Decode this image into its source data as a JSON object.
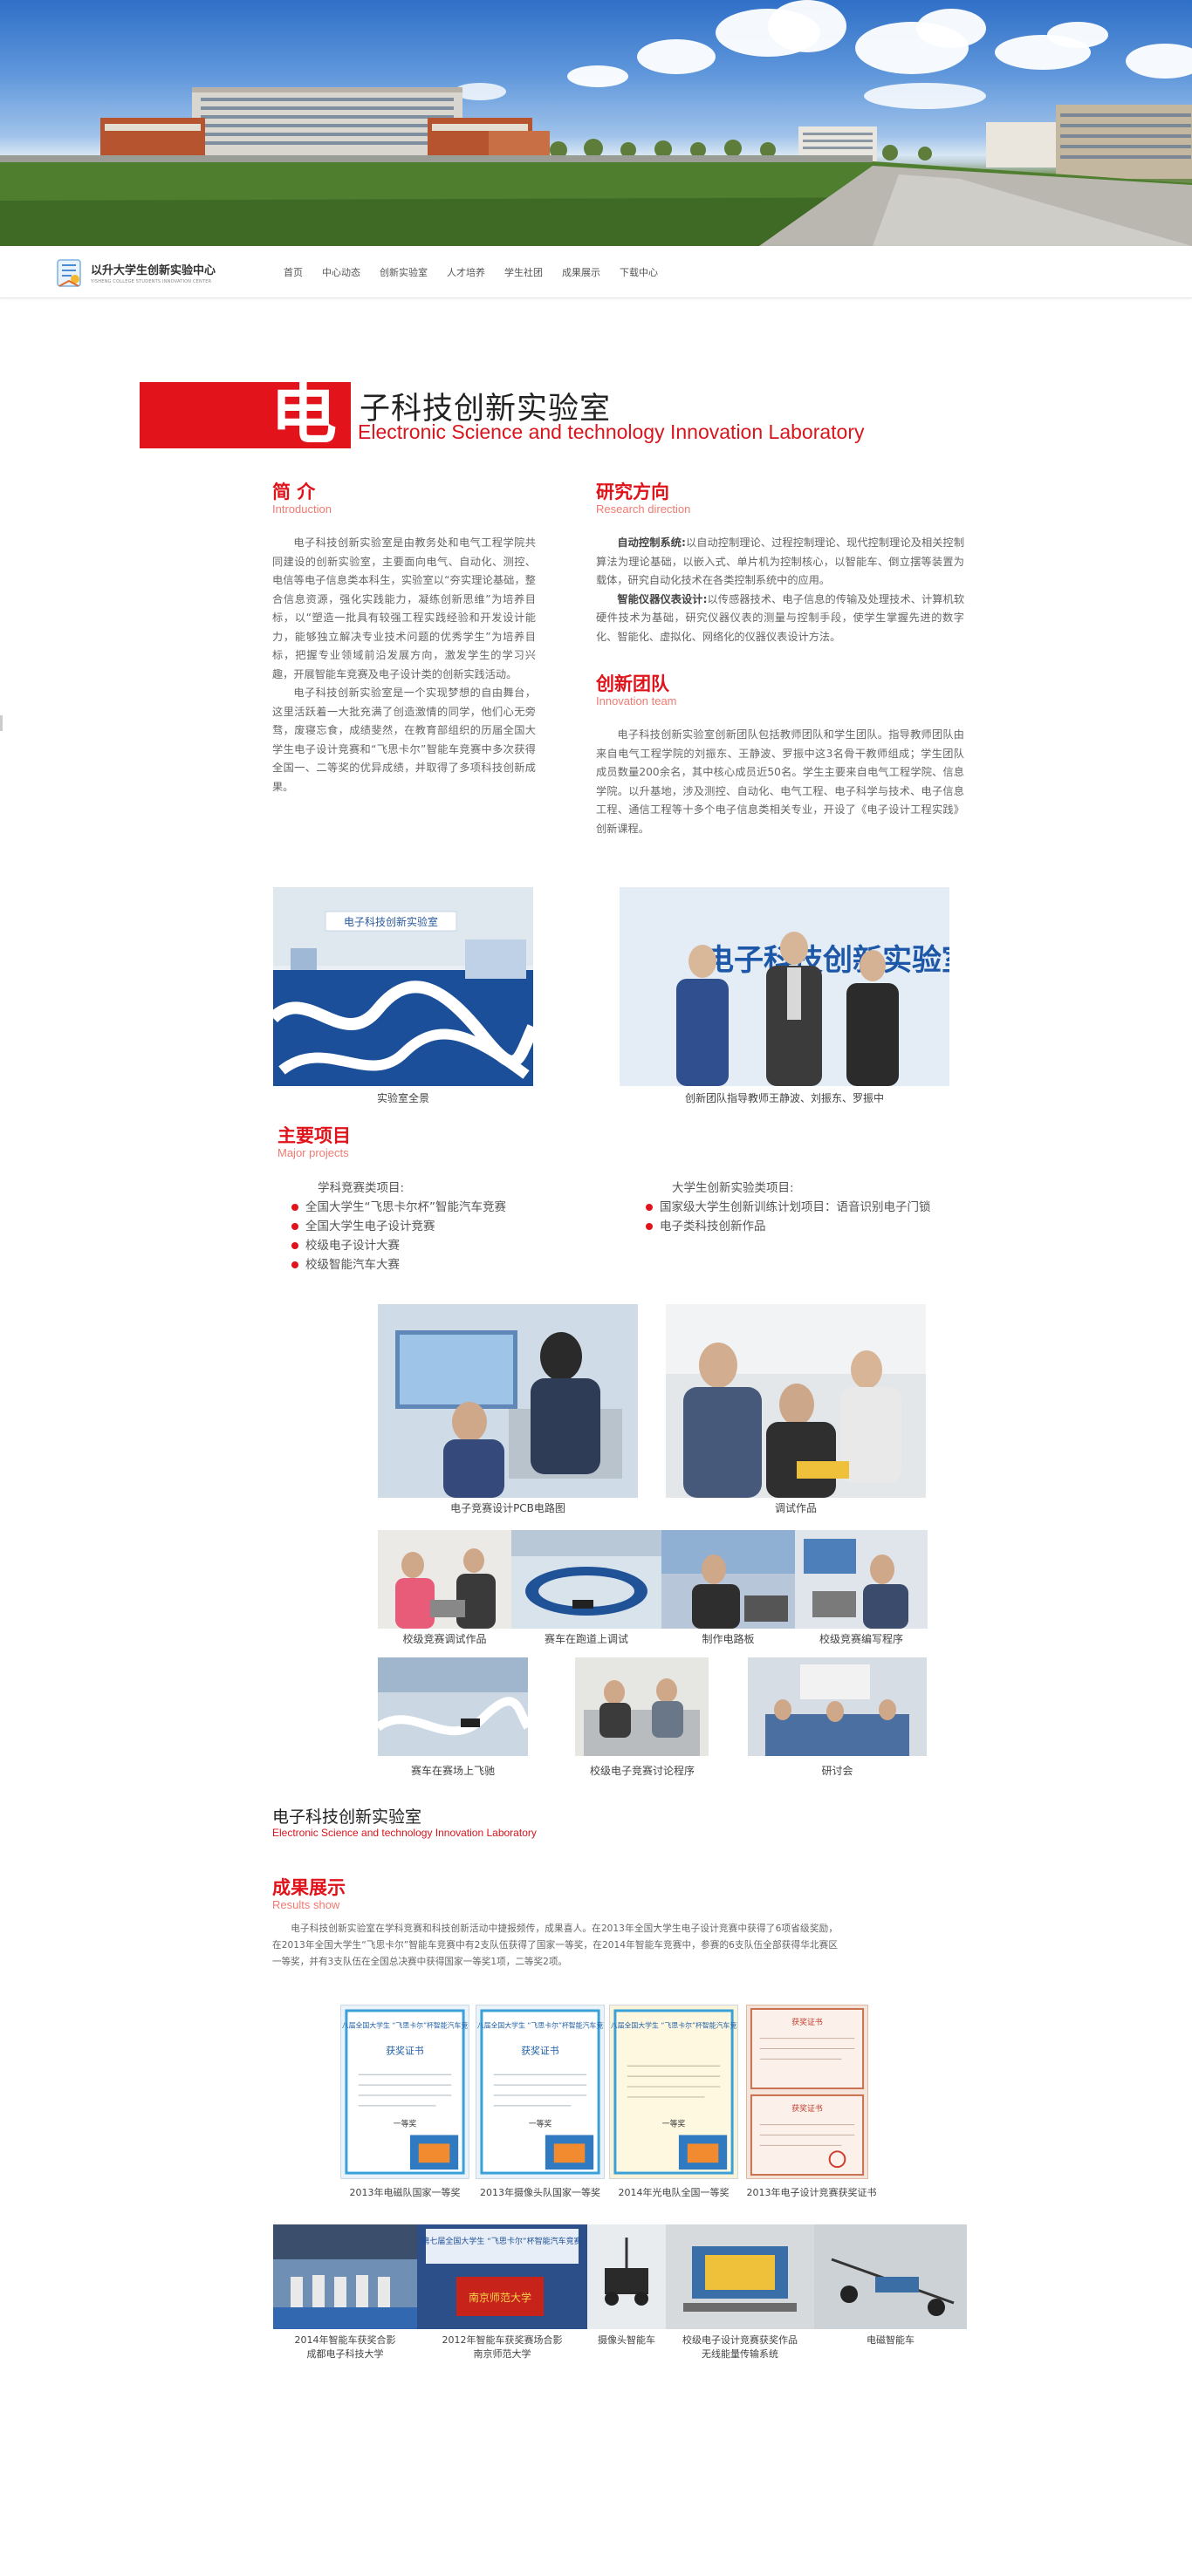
{
  "header": {
    "logo_title": "以升大学生创新实验中心",
    "logo_subtitle": "YISHENG COLLEGE STUDENTS INNOVATION CENTER",
    "nav": [
      "首页",
      "中心动态",
      "创新实验室",
      "人才培养",
      "学生社团",
      "成果展示",
      "下载中心"
    ]
  },
  "lab": {
    "big_char": "电",
    "title_cn": "子科技创新实验室",
    "title_en": "Electronic Science and technology Innovation Laboratory"
  },
  "intro": {
    "title": "简 介",
    "subtitle": "Introduction",
    "p1": "电子科技创新实验室是由教务处和电气工程学院共同建设的创新实验室，主要面向电气、自动化、测控、电信等电子信息类本科生，实验室以“夯实理论基础，整合信息资源，强化实践能力，凝练创新思维”为培养目标，以“塑造一批具有较强工程实践经验和开发设计能力，能够独立解决专业技术问题的优秀学生”为培养目标，把握专业领域前沿发展方向，激发学生的学习兴趣，开展智能车竞赛及电子设计类的创新实践活动。",
    "p2": "电子科技创新实验室是一个实现梦想的自由舞台，这里活跃着一大批充满了创造激情的同学，他们心无旁骛，废寝忘食，成绩斐然，在教育部组织的历届全国大学生电子设计竞赛和“飞思卡尔”智能车竞赛中多次获得全国一、二等奖的优异成绩，并取得了多项科技创新成果。"
  },
  "research": {
    "title": "研究方向",
    "subtitle": "Research direction",
    "item1_label": "自动控制系统:",
    "item1_text": "以自动控制理论、过程控制理论、现代控制理论及相关控制算法为理论基础，以嵌入式、单片机为控制核心，以智能车、倒立摆等装置为载体，研究自动化技术在各类控制系统中的应用。",
    "item2_label": "智能仪器仪表设计:",
    "item2_text": "以传感器技术、电子信息的传输及处理技术、计算机软硬件技术为基础，研究仪器仪表的测量与控制手段，使学生掌握先进的数字化、智能化、虚拟化、网络化的仪器仪表设计方法。"
  },
  "team": {
    "title": "创新团队",
    "subtitle": "Innovation team",
    "p1": "电子科技创新实验室创新团队包括教师团队和学生团队。指导教师团队由来自电气工程学院的刘振东、王静波、罗振中这3名骨干教师组成；学生团队成员数量200余名，其中核心成员近50名。学生主要来自电气工程学院、信息学院。以升基地，涉及测控、自动化、电气工程、电子科学与技术、电子信息工程、通信工程等十多个电子信息类相关专业，开设了《电子设计工程实践》创新课程。"
  },
  "photos_top": {
    "cap1": "实验室全景",
    "cap2": "创新团队指导教师王静波、刘振东、罗振中",
    "sign1": "电子科技创新实验室",
    "sign2": "电子科技创新实验室"
  },
  "projects": {
    "title": "主要项目",
    "subtitle": "Major projects",
    "left_head": "学科竞赛类项目:",
    "left_items": [
      "全国大学生“飞思卡尔杯”智能汽车竞赛",
      "全国大学生电子设计竞赛",
      "校级电子设计大赛",
      "校级智能汽车大赛"
    ],
    "right_head": "大学生创新实验类项目:",
    "right_items": [
      "国家级大学生创新训练计划项目：语音识别电子门锁",
      "电子类科技创新作品"
    ]
  },
  "gallery": {
    "row1": [
      "电子竞赛设计PCB电路图",
      "调试作品"
    ],
    "row2": [
      "校级竞赛调试作品",
      "赛车在跑道上调试",
      "制作电路板",
      "校级竞赛编写程序"
    ],
    "row3": [
      "赛车在赛场上飞驰",
      "校级电子竞赛讨论程序",
      "研讨会"
    ]
  },
  "footer_lab": {
    "cn": "电子科技创新实验室",
    "en": "Electronic Science and technology Innovation Laboratory"
  },
  "results": {
    "title": "成果展示",
    "subtitle": "Results show",
    "p1": "电子科技创新实验室在学科竞赛和科技创新活动中捷报频传，成果喜人。在2013年全国大学生电子设计竞赛中获得了6项省级奖励，在2013年全国大学生“飞思卡尔”智能车竞赛中有2支队伍获得了国家一等奖，在2014年智能车竞赛中，参赛的6支队伍全部获得华北赛区一等奖，并有3支队伍在全国总决赛中获得国家一等奖1项，二等奖2项。",
    "certs": [
      "2013年电磁队国家一等奖",
      "2013年摄像头队国家一等奖",
      "2014年光电队全国一等奖",
      "2013年电子设计竞赛获奖证书"
    ],
    "cert_title": "获奖证书",
    "cert_head": "第八届全国大学生 “飞思卡尔”杯智能汽车竞赛",
    "cert_prize": "一等奖",
    "cert_red_title": "获奖证书",
    "bottom": [
      {
        "line1": "2014年智能车获奖合影",
        "line2": "成都电子科技大学"
      },
      {
        "line1": "2012年智能车获奖赛场合影",
        "line2": "南京师范大学"
      },
      {
        "line1": "摄像头智能车",
        "line2": ""
      },
      {
        "line1": "校级电子设计竞赛获奖作品",
        "line2": "无线能量传输系统"
      },
      {
        "line1": "电磁智能车",
        "line2": ""
      }
    ],
    "banner_flag": "第七届全国大学生 “飞思卡尔”杯智能汽车竞赛",
    "banner_uni": "南京师范大学"
  },
  "colors": {
    "accent": "#e0121a",
    "subtitle": "#f07a72",
    "text": "#666666"
  }
}
